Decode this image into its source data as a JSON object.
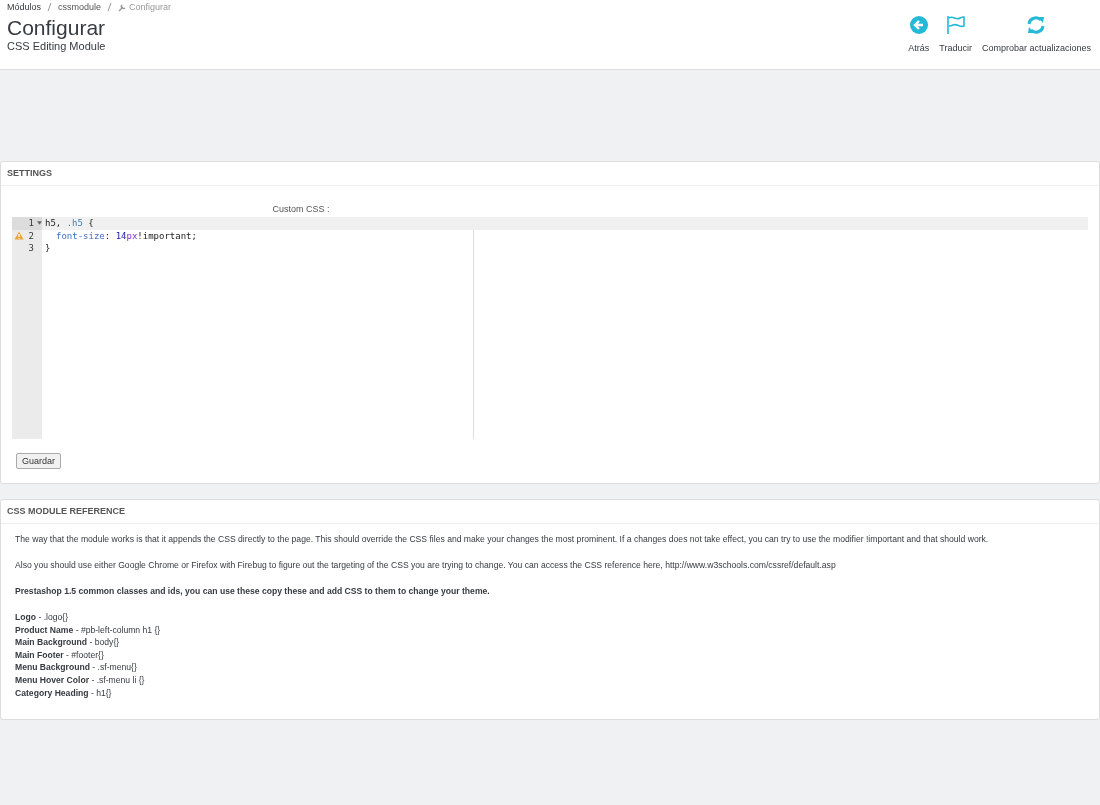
{
  "breadcrumb": [
    {
      "text": "Módulos",
      "kind": "link"
    },
    {
      "text": "cssmodule",
      "kind": "link"
    },
    {
      "text": "Configurar",
      "kind": "current"
    }
  ],
  "page_title": "Configurar",
  "page_subtitle": "CSS Editing Module",
  "toolbar": [
    {
      "label": "Atrás",
      "kind": "back"
    },
    {
      "label": "Traducir",
      "kind": "flag"
    },
    {
      "label": "Comprobar actualizaciones",
      "kind": "refresh"
    }
  ],
  "settings": {
    "heading": "SETTINGS",
    "field_label": "Custom CSS :",
    "code_lines": [
      {
        "number": "1",
        "active": true,
        "foldable": true,
        "warning": false,
        "indented": false,
        "tokens": [
          {
            "text": "h5, ",
            "kind": "plain"
          },
          {
            "text": ".h5",
            "kind": "selector"
          },
          {
            "text": " {",
            "kind": "plain"
          }
        ]
      },
      {
        "number": "2",
        "active": false,
        "foldable": false,
        "warning": true,
        "indented": true,
        "tokens": [
          {
            "text": "font-size",
            "kind": "property"
          },
          {
            "text": ": ",
            "kind": "plain"
          },
          {
            "text": "14",
            "kind": "number"
          },
          {
            "text": "px",
            "kind": "unit"
          },
          {
            "text": "!important;",
            "kind": "plain"
          }
        ]
      },
      {
        "number": "3",
        "active": false,
        "foldable": false,
        "warning": false,
        "indented": false,
        "tokens": [
          {
            "text": "}",
            "kind": "plain"
          }
        ]
      }
    ],
    "save_button": "Guardar"
  },
  "reference": {
    "heading": "CSS MODULE REFERENCE",
    "paragraphs": [
      {
        "text": "The way that the module works is that it appends the CSS directly to the page. This should override the CSS files and make your changes the most prominent. If a changes does not take effect, you can try to use the modifier !important and that should work.",
        "kind": "plain"
      },
      {
        "text": "Also you should use either Google Chrome or Firefox with Firebug to figure out the targeting of the CSS you are trying to change. You can access the CSS reference here, http://www.w3schools.com/cssref/default.asp",
        "kind": "plain"
      },
      {
        "text": "Prestashop 1.5 common classes and ids, you can use these copy these and add CSS to them to change your theme.",
        "kind": "bold"
      }
    ],
    "items": [
      "**Logo** - .logo{}",
      "**Product Name** - #pb-left-column h1 {}",
      "**Main Background** - body{}",
      "**Main Footer** - #footer{}",
      "**Menu Background** - .sf-menu{}",
      "**Menu Hover Color** - .sf-menu li {}",
      "**Category Heading** - h1{}"
    ]
  }
}
